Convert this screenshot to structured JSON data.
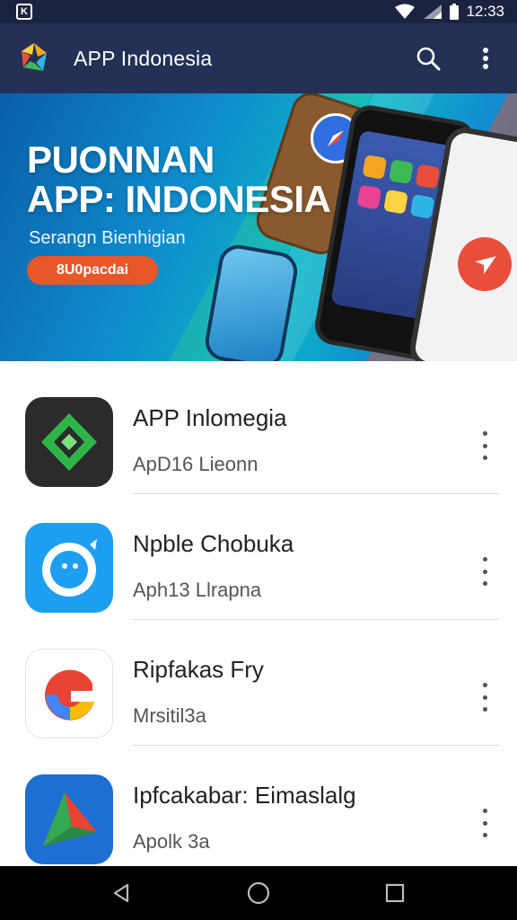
{
  "status_bar": {
    "time": "12:33"
  },
  "app_bar": {
    "title": "APP Indonesia",
    "icons": [
      "app-logo-icon",
      "search-icon",
      "more-vert-icon"
    ]
  },
  "banner": {
    "title_line1": "PUONNAN",
    "title_line2": "APP: INDONESIA",
    "subtitle": "Serangn Bienhigian",
    "cta": "8U0pacdai"
  },
  "apps": [
    {
      "name": "APP Inlomegia",
      "subtitle": "ApD16 Lieonn",
      "icon": "green-diamond-icon"
    },
    {
      "name": "Npble Chobuka",
      "subtitle": "Aph13 Llrapna",
      "icon": "blue-bubble-icon"
    },
    {
      "name": "Ripfakas Fry",
      "subtitle": "Mrsitil3a",
      "icon": "g-logo-icon"
    },
    {
      "name": "Ipfcakabar: Eimaslalg",
      "subtitle": "Apolk 3a",
      "icon": "triangle-icon"
    }
  ],
  "nav_bar": {
    "icons": [
      "back-icon",
      "home-icon",
      "recents-icon"
    ]
  },
  "colors": {
    "status_bar": "#1b2340",
    "app_bar": "#243056",
    "cta": "#e8562a"
  }
}
